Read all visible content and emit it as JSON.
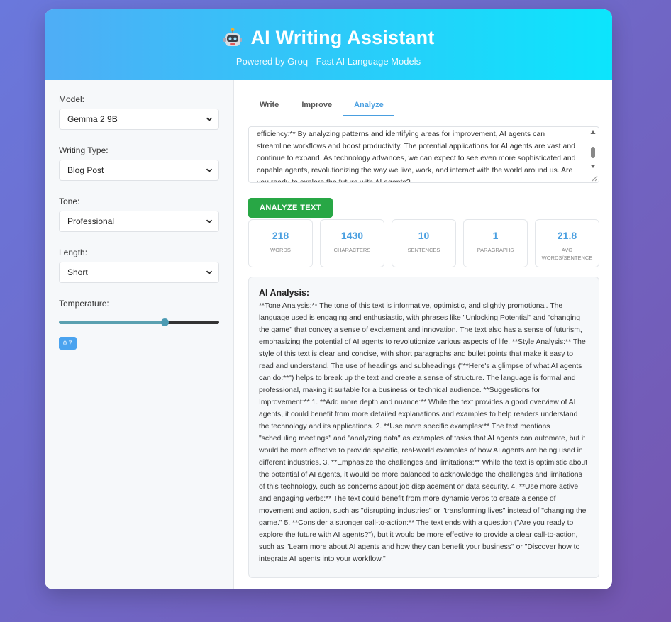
{
  "header": {
    "title": "AI Writing Assistant",
    "subtitle": "Powered by Groq - Fast AI Language Models",
    "icon": "robot-icon"
  },
  "sidebar": {
    "model_label": "Model:",
    "model_value": "Gemma 2 9B",
    "writing_type_label": "Writing Type:",
    "writing_type_value": "Blog Post",
    "tone_label": "Tone:",
    "tone_value": "Professional",
    "length_label": "Length:",
    "length_value": "Short",
    "temperature_label": "Temperature:",
    "temperature_value": "0.7",
    "temperature_level": 0.66
  },
  "tabs": [
    {
      "label": "Write",
      "active": false
    },
    {
      "label": "Improve",
      "active": false
    },
    {
      "label": "Analyze",
      "active": true
    }
  ],
  "input_text": "efficiency:** By analyzing patterns and identifying areas for improvement, AI agents can streamline workflows and boost productivity. The potential applications for AI agents are vast and continue to expand. As technology advances, we can expect to see even more sophisticated and capable agents, revolutionizing the way we live, work, and interact with the world around us. Are you ready to explore the future with AI agents?",
  "analyze_button": "ANALYZE TEXT",
  "stats": [
    {
      "value": "218",
      "label": "WORDS"
    },
    {
      "value": "1430",
      "label": "CHARACTERS"
    },
    {
      "value": "10",
      "label": "SENTENCES"
    },
    {
      "value": "1",
      "label": "PARAGRAPHS"
    },
    {
      "value": "21.8",
      "label": "AVG WORDS/SENTENCE"
    }
  ],
  "analysis": {
    "title": "AI Analysis:",
    "text": "**Tone Analysis:** The tone of this text is informative, optimistic, and slightly promotional. The language used is engaging and enthusiastic, with phrases like \"Unlocking Potential\" and \"changing the game\" that convey a sense of excitement and innovation. The text also has a sense of futurism, emphasizing the potential of AI agents to revolutionize various aspects of life. **Style Analysis:** The style of this text is clear and concise, with short paragraphs and bullet points that make it easy to read and understand. The use of headings and subheadings (\"**Here's a glimpse of what AI agents can do:**\") helps to break up the text and create a sense of structure. The language is formal and professional, making it suitable for a business or technical audience. **Suggestions for Improvement:** 1. **Add more depth and nuance:** While the text provides a good overview of AI agents, it could benefit from more detailed explanations and examples to help readers understand the technology and its applications. 2. **Use more specific examples:** The text mentions \"scheduling meetings\" and \"analyzing data\" as examples of tasks that AI agents can automate, but it would be more effective to provide specific, real-world examples of how AI agents are being used in different industries. 3. **Emphasize the challenges and limitations:** While the text is optimistic about the potential of AI agents, it would be more balanced to acknowledge the challenges and limitations of this technology, such as concerns about job displacement or data security. 4. **Use more active and engaging verbs:** The text could benefit from more dynamic verbs to create a sense of movement and action, such as \"disrupting industries\" or \"transforming lives\" instead of \"changing the game.\" 5. **Consider a stronger call-to-action:** The text ends with a question (\"Are you ready to explore the future with AI agents?\"), but it would be more effective to provide a clear call-to-action, such as \"Learn more about AI agents and how they can benefit your business\" or \"Discover how to integrate AI agents into your workflow.\""
  }
}
